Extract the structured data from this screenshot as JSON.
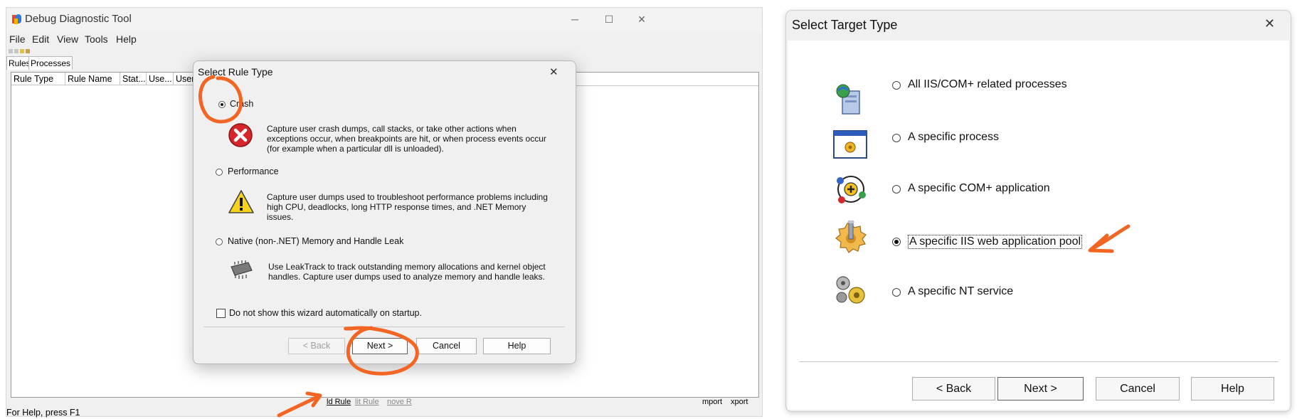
{
  "app": {
    "title": "Debug Diagnostic Tool",
    "window_controls": {
      "minimize": "─",
      "maximize": "☐",
      "close": "✕"
    },
    "menu": [
      "File",
      "Edit",
      "View",
      "Tools",
      "Help"
    ],
    "tabs": [
      "Rules",
      "Processes"
    ],
    "columns": [
      "Rule Type",
      "Rule Name",
      "Stat...",
      "Use...",
      "User"
    ],
    "bottom_buttons": [
      "ld Rule",
      "lit Rule",
      "nove R",
      "mport",
      "xport"
    ],
    "status": "For Help, press F1"
  },
  "rule_dialog": {
    "title": "Select Rule Type",
    "close": "✕",
    "options": [
      {
        "label": "Crash",
        "selected": true,
        "icon": "error-icon",
        "description": [
          "Capture user crash dumps, call stacks, or take other actions when",
          "exceptions occur, when breakpoints are hit, or when process events occur",
          "(for example when a particular dll is unloaded)."
        ]
      },
      {
        "label": "Performance",
        "selected": false,
        "icon": "warning-icon",
        "description": [
          "Capture user dumps used to troubleshoot performance problems including",
          "high CPU, deadlocks, long HTTP response times, and .NET Memory issues."
        ]
      },
      {
        "label": "Native (non-.NET) Memory and Handle Leak",
        "selected": false,
        "icon": "chip-icon",
        "description": [
          "Use LeakTrack to track outstanding memory allocations and kernel object",
          "handles. Capture user dumps used to analyze memory and handle leaks."
        ]
      }
    ],
    "checkbox_label": "Do not show this wizard automatically on startup.",
    "checkbox_checked": false,
    "buttons": {
      "back": "< Back",
      "next": "Next >",
      "cancel": "Cancel",
      "help": "Help"
    }
  },
  "target_dialog": {
    "title": "Select Target Type",
    "close": "✕",
    "options": [
      {
        "label": "All IIS/COM+ related processes",
        "selected": false,
        "icon": "server-globe-icon"
      },
      {
        "label": "A specific process",
        "selected": false,
        "icon": "process-window-icon"
      },
      {
        "label": "A specific COM+ application",
        "selected": false,
        "icon": "com-plus-icon"
      },
      {
        "label": "A specific IIS web application pool",
        "selected": true,
        "icon": "gear-icon"
      },
      {
        "label": "A specific NT service",
        "selected": false,
        "icon": "service-gears-icon"
      }
    ],
    "buttons": {
      "back": "< Back",
      "next": "Next >",
      "cancel": "Cancel",
      "help": "Help"
    }
  },
  "colors": {
    "annotation": "#f26522",
    "window_bg": "#f0f0f0"
  }
}
